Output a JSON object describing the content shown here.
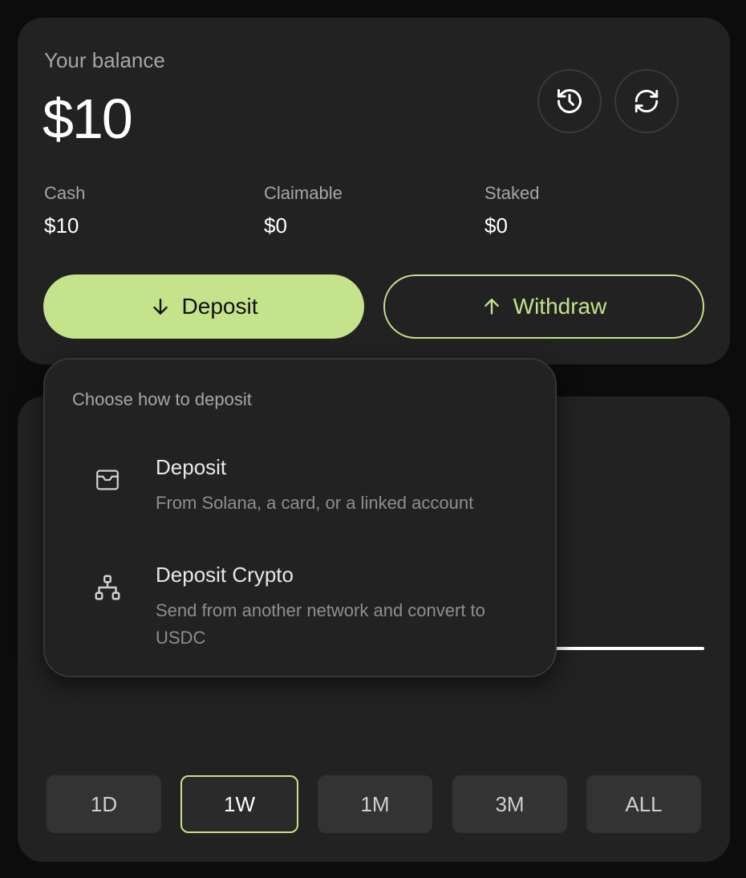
{
  "balance": {
    "label": "Your balance",
    "value": "$10",
    "stats": [
      {
        "label": "Cash",
        "value": "$10"
      },
      {
        "label": "Claimable",
        "value": "$0"
      },
      {
        "label": "Staked",
        "value": "$0"
      }
    ],
    "icons": {
      "history": "history-icon",
      "refresh": "refresh-icon"
    }
  },
  "actions": {
    "deposit_label": "Deposit",
    "withdraw_label": "Withdraw"
  },
  "deposit_menu": {
    "title": "Choose how to deposit",
    "items": [
      {
        "title": "Deposit",
        "subtitle": "From Solana, a card, or a linked account",
        "icon": "wallet-icon"
      },
      {
        "title": "Deposit Crypto",
        "subtitle": "Send from another network and convert to USDC",
        "icon": "network-icon"
      }
    ]
  },
  "time_ranges": {
    "options": [
      "1D",
      "1W",
      "1M",
      "3M",
      "ALL"
    ],
    "selected": "1W"
  },
  "colors": {
    "accent": "#c4e38a",
    "card_bg": "#222222",
    "page_bg": "#0c0c0c"
  }
}
